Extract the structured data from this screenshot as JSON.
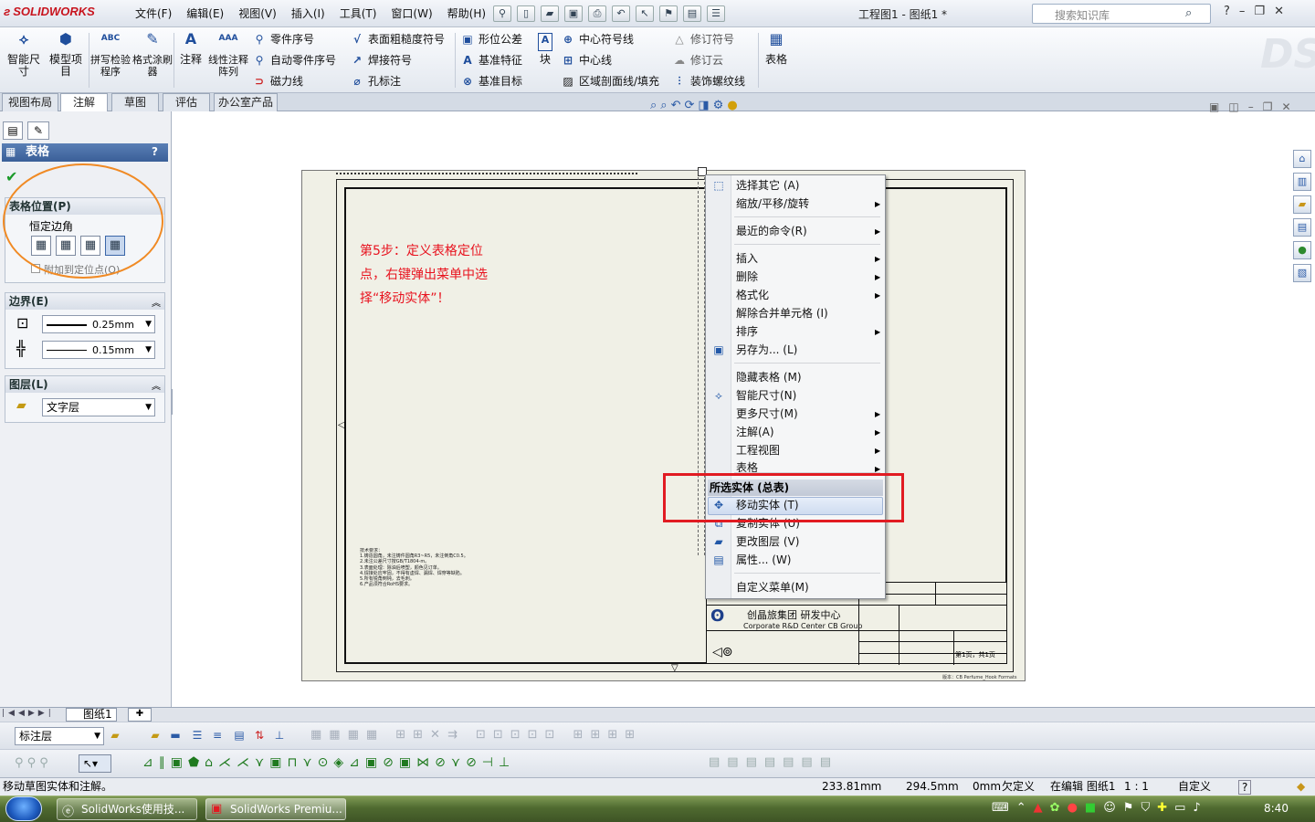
{
  "app": {
    "logo_text": "SOLIDWORKS",
    "doc_title": "工程图1 - 图纸1 *",
    "search_placeholder": "搜索知识库",
    "help_icon": "?"
  },
  "menubar": [
    "文件(F)",
    "编辑(E)",
    "视图(V)",
    "插入(I)",
    "工具(T)",
    "窗口(W)",
    "帮助(H)"
  ],
  "commands": {
    "big": [
      {
        "label": "智能尺寸",
        "icon": "smart-dimension-icon",
        "glyph": "⟡"
      },
      {
        "label": "模型项目",
        "icon": "model-items-icon",
        "glyph": "⬢"
      },
      {
        "label": "拼写检验程序",
        "icon": "spell-check-icon",
        "glyph": "ABC"
      },
      {
        "label": "格式涂刷器",
        "icon": "format-painter-icon",
        "glyph": "✎"
      },
      {
        "label": "注释",
        "icon": "note-icon",
        "glyph": "A"
      },
      {
        "label": "线性注释阵列",
        "icon": "linear-note-pattern-icon",
        "glyph": "AAA"
      }
    ],
    "col1": [
      "零件序号",
      "自动零件序号",
      "磁力线"
    ],
    "col2": [
      "表面粗糙度符号",
      "焊接符号",
      "孔标注"
    ],
    "col3": [
      "形位公差",
      "基准特征",
      "基准目标"
    ],
    "block": "块",
    "col4": [
      "中心符号线",
      "中心线",
      "区域剖面线/填充"
    ],
    "col5": [
      "修订符号",
      "修订云",
      "装饰螺纹线"
    ],
    "table": "表格"
  },
  "tabs": [
    "视图布局",
    "注解",
    "草图",
    "评估",
    "办公室产品"
  ],
  "active_tab": "注解",
  "panel": {
    "title": "表格",
    "help": "?",
    "position_group": "表格位置(P)",
    "constant_corner": "恒定边角",
    "attach_anchor": "附加到定位点(O)",
    "border_group": "边界(E)",
    "border_outer": "0.25mm",
    "border_inner": "0.15mm",
    "layer_group": "图层(L)",
    "layer_value": "文字层"
  },
  "annotation": "第5步：定义表格定位点，右键弹出菜单中选择“移动实体”！",
  "drawing": {
    "notes_title": "技术要求：",
    "notes": [
      "1.铸造圆角，未注铸件圆角R3~R5，未注倒角C0.5。",
      "2.未注公差尺寸按GB/T1804-m。",
      "3.表面处理：除油后喷塑，颜色见订单。",
      "4.焊接处应牢固，不得有虚焊、漏焊、焊穿等缺陷。",
      "5.所有锐角倒钝，去毛刺。",
      "6.产品须符合RoHS要求。"
    ],
    "company": "创晶旅集团 研发中心",
    "company_en": "Corporate R&D Center CB Group",
    "sheet_info": "第1页，共1页",
    "footer": "版本：CB Perfume_Hook Formats"
  },
  "context_menu": {
    "items": [
      {
        "label": "选择其它 (A)",
        "icon": "select-other-icon",
        "sub": false
      },
      {
        "label": "缩放/平移/旋转",
        "sub": true
      },
      {
        "label": "最近的命令(R)",
        "sub": true
      },
      {
        "label": "插入",
        "sub": true
      },
      {
        "label": "删除",
        "sub": true
      },
      {
        "label": "格式化",
        "sub": true
      },
      {
        "label": "解除合并单元格 (I)",
        "sub": false
      },
      {
        "label": "排序",
        "sub": true
      },
      {
        "label": "另存为... (L)",
        "icon": "save-as-icon",
        "sub": false
      },
      {
        "label": "隐藏表格 (M)",
        "sub": false
      },
      {
        "label": "智能尺寸(N)",
        "icon": "smart-dimension-icon",
        "sub": false
      },
      {
        "label": "更多尺寸(M)",
        "sub": true
      },
      {
        "label": "注解(A)",
        "sub": true
      },
      {
        "label": "工程视图",
        "sub": true
      },
      {
        "label": "表格",
        "sub": true
      },
      {
        "label": "移动实体 (T)",
        "icon": "move-entity-icon",
        "sub": false
      },
      {
        "label": "复制实体 (U)",
        "icon": "copy-entity-icon",
        "sub": false
      },
      {
        "label": "更改图层 (V)",
        "icon": "change-layer-icon",
        "sub": false
      },
      {
        "label": "属性... (W)",
        "icon": "properties-icon",
        "sub": false
      },
      {
        "label": "自定义菜单(M)",
        "sub": false
      }
    ],
    "section_header": "所选实体 (总表)",
    "highlighted": "移动实体 (T)"
  },
  "sheet_tab": "图纸1",
  "layer_combo": "标注层",
  "status": {
    "message": "移动草图实体和注解。",
    "x": "233.81mm",
    "y": "294.5mm",
    "z": "0mm",
    "state": "欠定义",
    "editing": "在编辑 图纸1",
    "scale": "1 : 1",
    "custom": "自定义",
    "help": "?"
  },
  "taskbar": {
    "tasks": [
      "SolidWorks使用技...",
      "SolidWorks Premiu..."
    ],
    "clock": "8:40"
  },
  "colors": {
    "annotation_red": "#e8131f",
    "highlight_box": "#e11b22",
    "orange_circle": "#f08a24",
    "panel_head": "#3a5f98"
  }
}
